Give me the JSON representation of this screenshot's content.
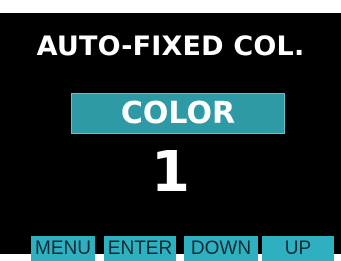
{
  "screen": {
    "title": "AUTO-FIXED COL.",
    "mode": "COLOR",
    "value": "1"
  },
  "softkeys": [
    {
      "label": "MENU"
    },
    {
      "label": "ENTER"
    },
    {
      "label": "DOWN"
    },
    {
      "label": "UP"
    }
  ],
  "colors": {
    "background": "#000000",
    "mode_highlight": "#2e9aa6",
    "softkey": "#2eb0c0",
    "text": "#ffffff"
  }
}
